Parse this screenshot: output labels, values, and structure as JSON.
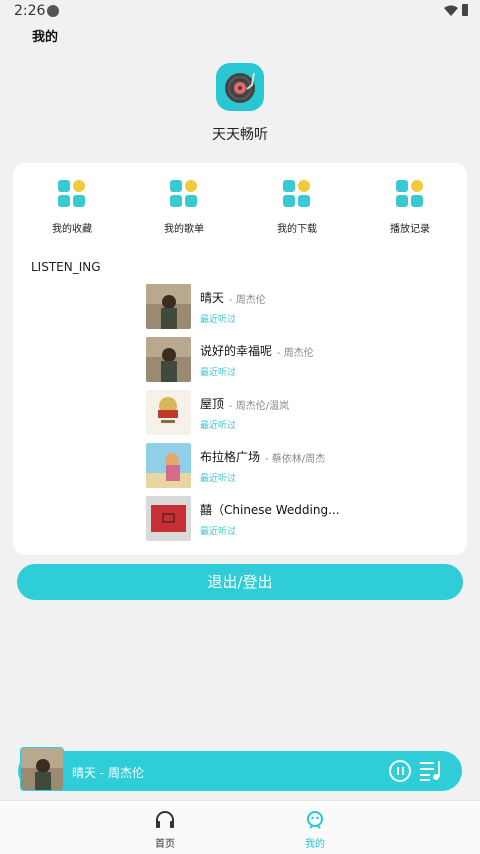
{
  "status": {
    "time": "2:26"
  },
  "page": {
    "title": "我的"
  },
  "app": {
    "name": "天天畅听"
  },
  "features": [
    {
      "label": "我的收藏"
    },
    {
      "label": "我的歌单"
    },
    {
      "label": "我的下载"
    },
    {
      "label": "播放记录"
    }
  ],
  "section": {
    "title": "LISTEN_ING"
  },
  "songs": [
    {
      "title": "晴天",
      "artist": " - 周杰伦",
      "recent": "最近听过"
    },
    {
      "title": "说好的幸福呢",
      "artist": " - 周杰伦",
      "recent": "最近听过"
    },
    {
      "title": "屋顶",
      "artist": " - 周杰伦/温岚",
      "recent": "最近听过"
    },
    {
      "title": "布拉格广场",
      "artist": " - 蔡依林/周杰",
      "recent": "最近听过"
    },
    {
      "title": "囍（Chinese Wedding...",
      "artist": "",
      "recent": "最近听过"
    }
  ],
  "logout": {
    "label": "退出/登出"
  },
  "player": {
    "title": "晴天 - 周杰伦"
  },
  "nav": {
    "home": "首页",
    "mine": "我的"
  },
  "colors": {
    "accent": "#2ecdd7",
    "feature_yellow": "#f3c93c"
  }
}
